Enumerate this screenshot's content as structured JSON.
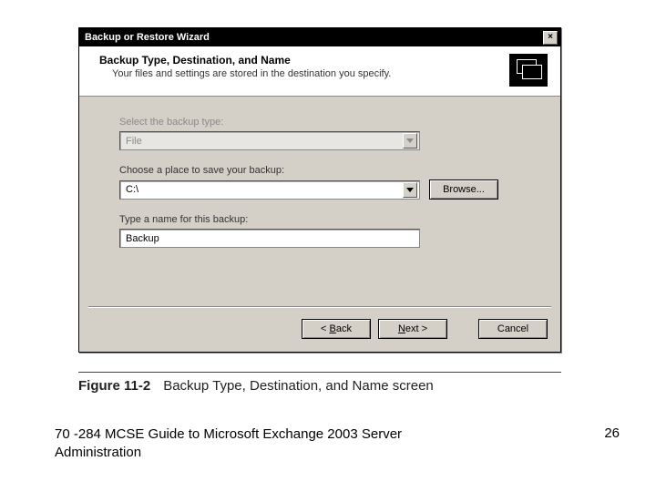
{
  "window": {
    "title": "Backup or Restore Wizard",
    "close_symbol": "×"
  },
  "header": {
    "title": "Backup Type, Destination, and Name",
    "subtitle": "Your files and settings are stored in the destination you specify."
  },
  "fields": {
    "type_label": "Select the backup type:",
    "type_value": "File",
    "place_label": "Choose a place to save your backup:",
    "place_value": "C:\\",
    "browse_label": "Browse...",
    "name_label": "Type a name for this backup:",
    "name_value": "Backup"
  },
  "buttons": {
    "back_prefix": "< ",
    "back_u": "B",
    "back_rest": "ack",
    "next_u": "N",
    "next_rest": "ext >",
    "cancel": "Cancel"
  },
  "caption": {
    "fig": "Figure 11-2",
    "text": "Backup Type, Destination, and Name screen"
  },
  "footer": {
    "book": "70 -284 MCSE Guide to Microsoft Exchange 2003 Server Administration",
    "page": "26"
  }
}
